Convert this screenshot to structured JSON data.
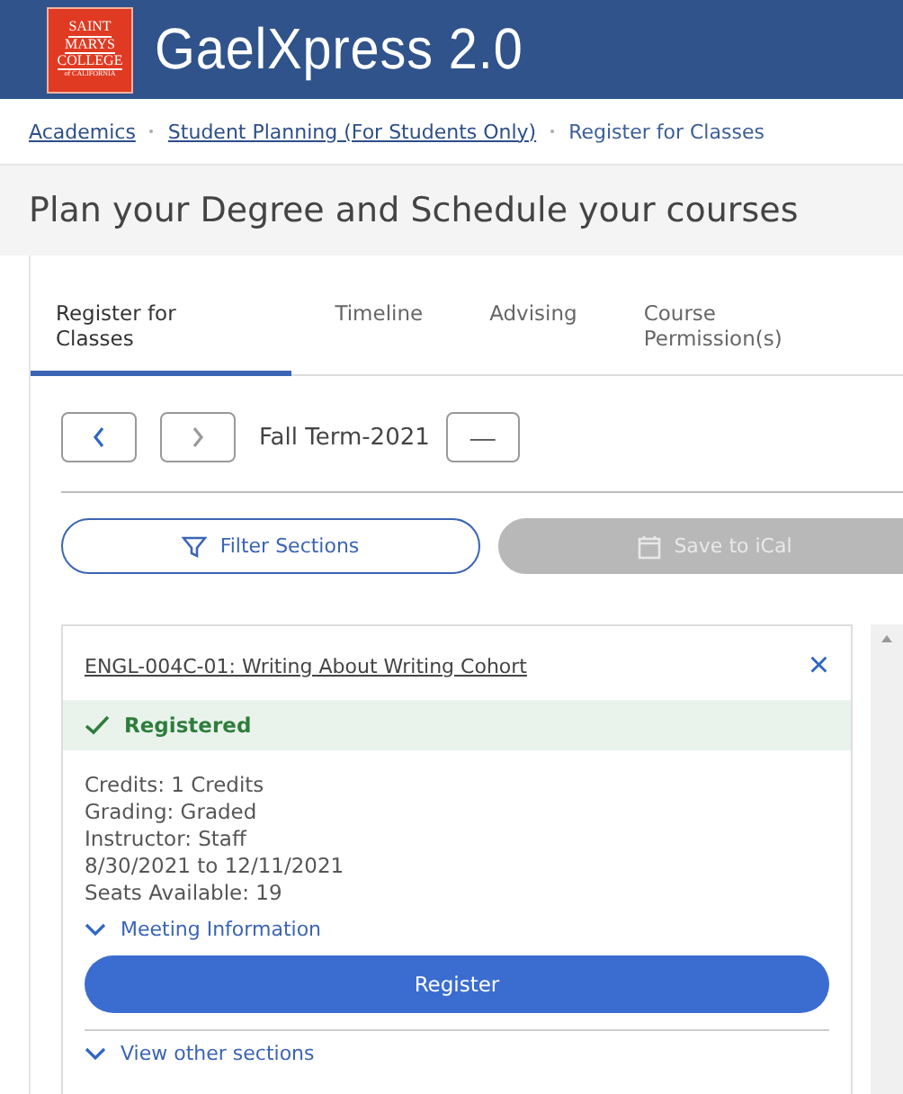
{
  "header": {
    "logo_lines": [
      "SAINT",
      "MARYS",
      "COLLEGE",
      "of CALIFORNIA"
    ],
    "title": "GaelXpress 2.0"
  },
  "breadcrumbs": [
    {
      "label": "Academics",
      "link": true
    },
    {
      "label": "Student Planning (For Students Only)",
      "link": true
    },
    {
      "label": "Register for Classes",
      "link": false
    }
  ],
  "page_title": "Plan your Degree and Schedule your courses",
  "tabs": [
    {
      "label": "Register for Classes",
      "selected": true
    },
    {
      "label": "Timeline",
      "selected": false
    },
    {
      "label": "Advising",
      "selected": false
    },
    {
      "label": "Course Permission(s)",
      "selected": false
    }
  ],
  "term": {
    "label": "Fall Term-2021",
    "collapse": "—"
  },
  "actions": [
    {
      "label": "Filter Sections",
      "kind": "filter",
      "disabled": false
    },
    {
      "label": "Save to iCal",
      "kind": "calendar",
      "disabled": true
    }
  ],
  "course": {
    "title": "ENGL-004C-01: Writing About Writing Cohort",
    "close": "×",
    "status": "Registered",
    "registered": true,
    "details": [
      "Credits: 1 Credits",
      "Grading: Graded",
      "Instructor: Staff",
      "8/30/2021 to 12/11/2021",
      "Seats Available:  19"
    ],
    "meeting_info": "Meeting Information",
    "register_button": "Register",
    "other_sections": "View other sections"
  }
}
